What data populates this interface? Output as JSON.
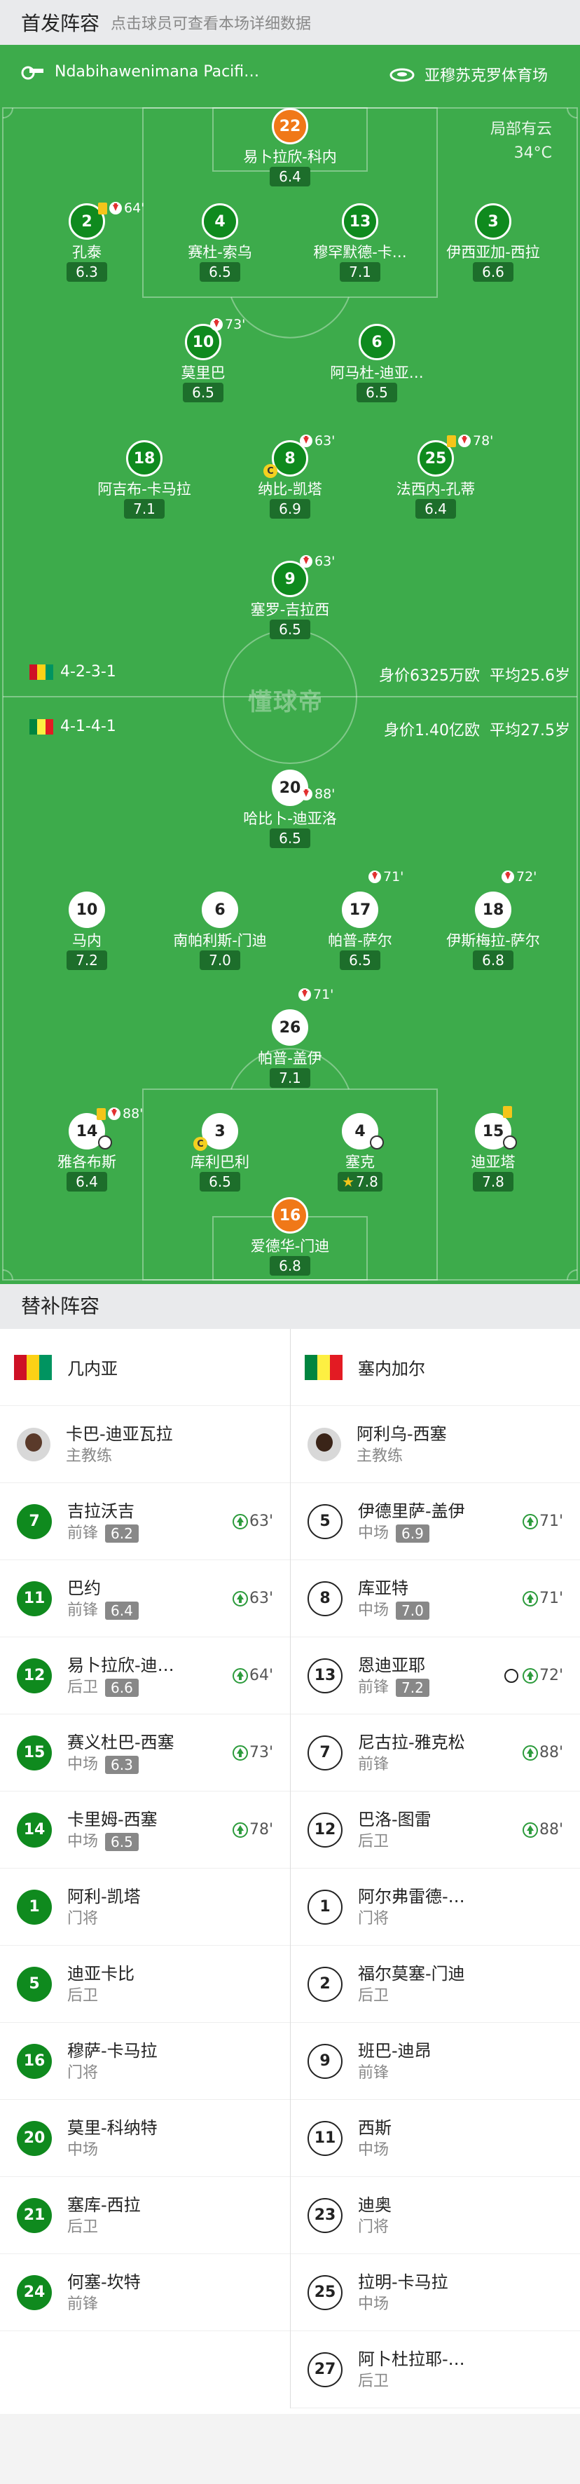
{
  "header": {
    "title": "首发阵容",
    "hint": "点击球员可查看本场详细数据"
  },
  "pitch_info": {
    "referee": "Ndabihawenimana Pacifi…",
    "stadium": "亚穆苏克罗体育场",
    "weather": "局部有云",
    "temp": "34°C",
    "watermark": "懂球帝"
  },
  "formations": {
    "home": {
      "formation": "4-2-3-1",
      "value": "身价6325万欧",
      "age": "平均25.6岁"
    },
    "away": {
      "formation": "4-1-4-1",
      "value": "身价1.40亿欧",
      "age": "平均27.5岁"
    }
  },
  "home_players": [
    {
      "num": "22",
      "name": "易卜拉欣-科内",
      "rating": "6.4"
    },
    {
      "num": "2",
      "name": "孔泰",
      "rating": "6.3",
      "sub": "64'"
    },
    {
      "num": "4",
      "name": "赛杜-索乌",
      "rating": "6.5"
    },
    {
      "num": "13",
      "name": "穆罕默德-卡…",
      "rating": "7.1"
    },
    {
      "num": "3",
      "name": "伊西亚加-西拉",
      "rating": "6.6"
    },
    {
      "num": "10",
      "name": "莫里巴",
      "rating": "6.5",
      "sub": "73'"
    },
    {
      "num": "6",
      "name": "阿马杜-迪亚…",
      "rating": "6.5"
    },
    {
      "num": "18",
      "name": "阿吉布-卡马拉",
      "rating": "7.1"
    },
    {
      "num": "8",
      "name": "纳比-凯塔",
      "rating": "6.9",
      "sub": "63'"
    },
    {
      "num": "25",
      "name": "法西内-孔蒂",
      "rating": "6.4",
      "sub": "78'"
    },
    {
      "num": "9",
      "name": "塞罗-吉拉西",
      "rating": "6.5",
      "sub": "63'"
    }
  ],
  "away_players": [
    {
      "num": "20",
      "name": "哈比卜-迪亚洛",
      "rating": "6.5",
      "sub": "88'"
    },
    {
      "num": "10",
      "name": "马内",
      "rating": "7.2"
    },
    {
      "num": "6",
      "name": "南帕利斯-门迪",
      "rating": "7.0"
    },
    {
      "num": "17",
      "name": "帕普-萨尔",
      "rating": "6.5",
      "sub": "71'"
    },
    {
      "num": "18",
      "name": "伊斯梅拉-萨尔",
      "rating": "6.8",
      "sub": "72'"
    },
    {
      "num": "26",
      "name": "帕普-盖伊",
      "rating": "7.1",
      "sub": "71'"
    },
    {
      "num": "14",
      "name": "雅各布斯",
      "rating": "6.4",
      "sub": "88'"
    },
    {
      "num": "3",
      "name": "库利巴利",
      "rating": "6.5"
    },
    {
      "num": "4",
      "name": "塞克",
      "rating": "7.8"
    },
    {
      "num": "15",
      "name": "迪亚塔",
      "rating": "7.8"
    },
    {
      "num": "16",
      "name": "爱德华-门迪",
      "rating": "6.8"
    }
  ],
  "subs_header": "替补阵容",
  "home_team": {
    "name": "几内亚",
    "coach": "卡巴-迪亚瓦拉",
    "coach_role": "主教练"
  },
  "away_team": {
    "name": "塞内加尔",
    "coach": "阿利乌-西塞",
    "coach_role": "主教练"
  },
  "home_subs": [
    {
      "num": "7",
      "name": "吉拉沃吉",
      "pos": "前锋",
      "rating": "6.2",
      "time": "63'"
    },
    {
      "num": "11",
      "name": "巴约",
      "pos": "前锋",
      "rating": "6.4",
      "time": "63'"
    },
    {
      "num": "12",
      "name": "易卜拉欣-迪…",
      "pos": "后卫",
      "rating": "6.6",
      "time": "64'"
    },
    {
      "num": "15",
      "name": "赛义杜巴-西塞",
      "pos": "中场",
      "rating": "6.3",
      "time": "73'"
    },
    {
      "num": "14",
      "name": "卡里姆-西塞",
      "pos": "中场",
      "rating": "6.5",
      "time": "78'"
    },
    {
      "num": "1",
      "name": "阿利-凯塔",
      "pos": "门将"
    },
    {
      "num": "5",
      "name": "迪亚卡比",
      "pos": "后卫"
    },
    {
      "num": "16",
      "name": "穆萨-卡马拉",
      "pos": "门将"
    },
    {
      "num": "20",
      "name": "莫里-科纳特",
      "pos": "中场"
    },
    {
      "num": "21",
      "name": "塞库-西拉",
      "pos": "后卫"
    },
    {
      "num": "24",
      "name": "何塞-坎特",
      "pos": "前锋"
    }
  ],
  "away_subs": [
    {
      "num": "5",
      "name": "伊德里萨-盖伊",
      "pos": "中场",
      "rating": "6.9",
      "time": "71'"
    },
    {
      "num": "8",
      "name": "库亚特",
      "pos": "中场",
      "rating": "7.0",
      "time": "71'"
    },
    {
      "num": "13",
      "name": "恩迪亚耶",
      "pos": "前锋",
      "rating": "7.2",
      "time": "72'"
    },
    {
      "num": "7",
      "name": "尼古拉-雅克松",
      "pos": "前锋",
      "time": "88'"
    },
    {
      "num": "12",
      "name": "巴洛-图雷",
      "pos": "后卫",
      "time": "88'"
    },
    {
      "num": "1",
      "name": "阿尔弗雷德-…",
      "pos": "门将"
    },
    {
      "num": "2",
      "name": "福尔莫塞-门迪",
      "pos": "后卫"
    },
    {
      "num": "9",
      "name": "班巴-迪昂",
      "pos": "前锋"
    },
    {
      "num": "11",
      "name": "西斯",
      "pos": "中场"
    },
    {
      "num": "23",
      "name": "迪奥",
      "pos": "门将"
    },
    {
      "num": "25",
      "name": "拉明-卡马拉",
      "pos": "中场"
    },
    {
      "num": "27",
      "name": "阿卜杜拉耶-…",
      "pos": "后卫"
    }
  ],
  "colors": {
    "pitch": "#3dab4b",
    "home": "#0f8a1e",
    "highlight": "#f07818"
  }
}
